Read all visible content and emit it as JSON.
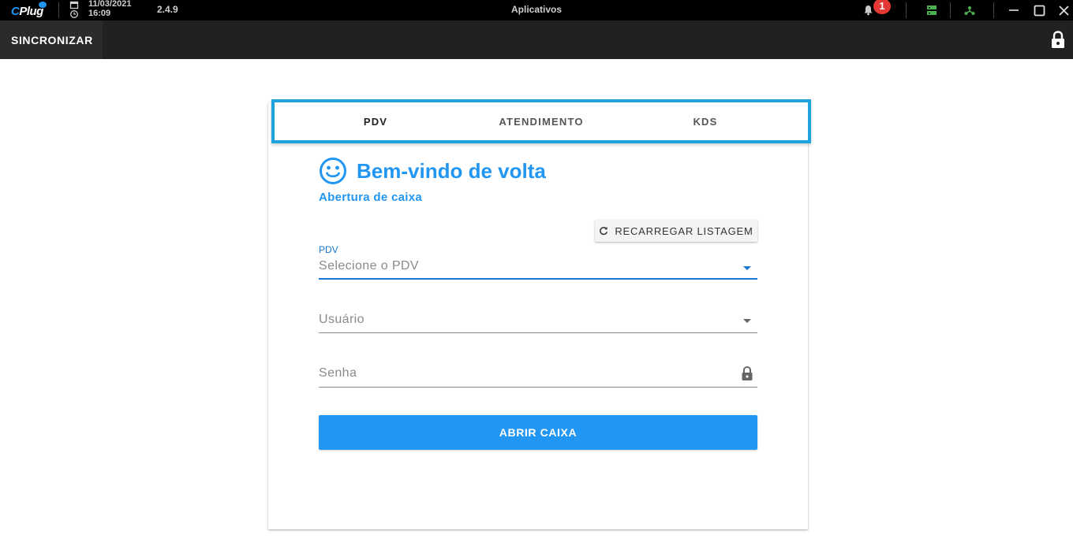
{
  "titlebar": {
    "logo": "CPlug",
    "date": "11/03/2021",
    "time": "16:09",
    "version": "2.4.9",
    "title": "Aplicativos",
    "notification_count": "1",
    "icons": [
      "bell-icon",
      "server-icon",
      "network-icon",
      "minimize-icon",
      "maximize-icon",
      "close-icon"
    ]
  },
  "appbar": {
    "sync_label": "SINCRONIZAR",
    "lock_icon": "lock-icon"
  },
  "tabs": [
    {
      "label": "PDV",
      "active": true
    },
    {
      "label": "ATENDIMENTO",
      "active": false
    },
    {
      "label": "KDS",
      "active": false
    }
  ],
  "main": {
    "welcome_title": "Bem-vindo de volta",
    "subtitle": "Abertura de caixa",
    "reload_label": "RECARREGAR LISTAGEM",
    "pdv_label": "PDV",
    "pdv_placeholder": "Selecione o PDV",
    "user_placeholder": "Usuário",
    "password_placeholder": "Senha",
    "submit_label": "ABRIR CAIXA"
  },
  "colors": {
    "primary": "#2196f3",
    "tab_highlight": "#1fa3dc",
    "badge": "#e53935",
    "status_green": "#4caf50"
  }
}
